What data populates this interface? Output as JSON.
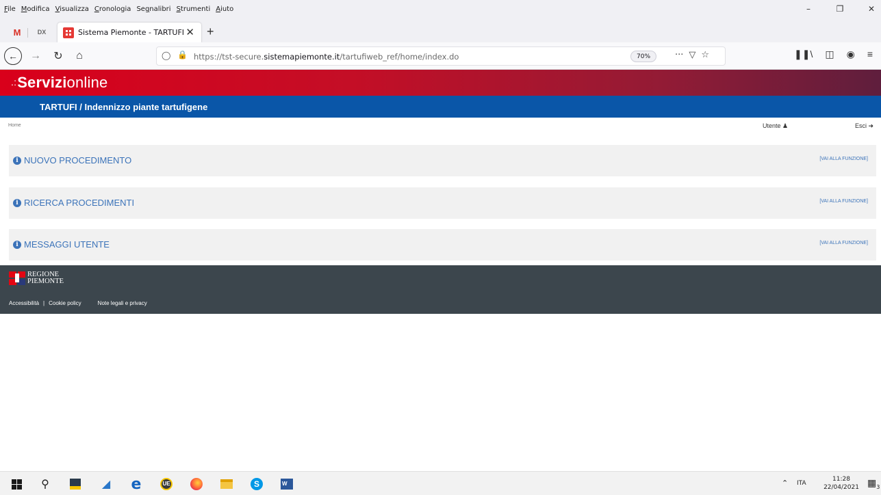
{
  "browser": {
    "menu": [
      "File",
      "Modifica",
      "Visualizza",
      "Cronologia",
      "Segnalibri",
      "Strumenti",
      "Aiuto"
    ],
    "menu_accel": [
      "F",
      "M",
      "V",
      "C",
      "g",
      "S",
      "A"
    ],
    "tab_title": "Sistema Piemonte - TARTUFI",
    "pinned_tabs": [
      "M",
      "DX"
    ],
    "url_prefix": "https://tst-secure.",
    "url_domain": "sistemapiemonte.it",
    "url_path": "/tartufiweb_ref/home/index.do",
    "zoom": "70%"
  },
  "header": {
    "brand_bold": "Servizi",
    "brand_light": "online",
    "app_title": "TARTUFI / Indennizzo piante tartufigene"
  },
  "nav": {
    "breadcrumb": "Home",
    "user_label": "Utente",
    "logout_label": "Esci"
  },
  "panels": [
    {
      "title": "NUOVO PROCEDIMENTO",
      "link": "[VAI ALLA FUNZIONE]"
    },
    {
      "title": "RICERCA PROCEDIMENTI",
      "link": "[VAI ALLA FUNZIONE]"
    },
    {
      "title": "MESSAGGI UTENTE",
      "link": "[VAI ALLA FUNZIONE]"
    }
  ],
  "footer": {
    "logo_line1": "REGIONE",
    "logo_line2": "PIEMONTE",
    "links": [
      "Accessibilità",
      "Cookie policy",
      "Note legali e privacy"
    ],
    "separator": "|"
  },
  "taskbar": {
    "lang": "ITA",
    "time": "11:28",
    "date": "22/04/2021",
    "notifications": "3"
  },
  "colors": {
    "servizi_red": "#d9001b",
    "app_blue": "#0a56a8",
    "link_blue": "#3b73b9",
    "footer_dark": "#3c464d"
  }
}
